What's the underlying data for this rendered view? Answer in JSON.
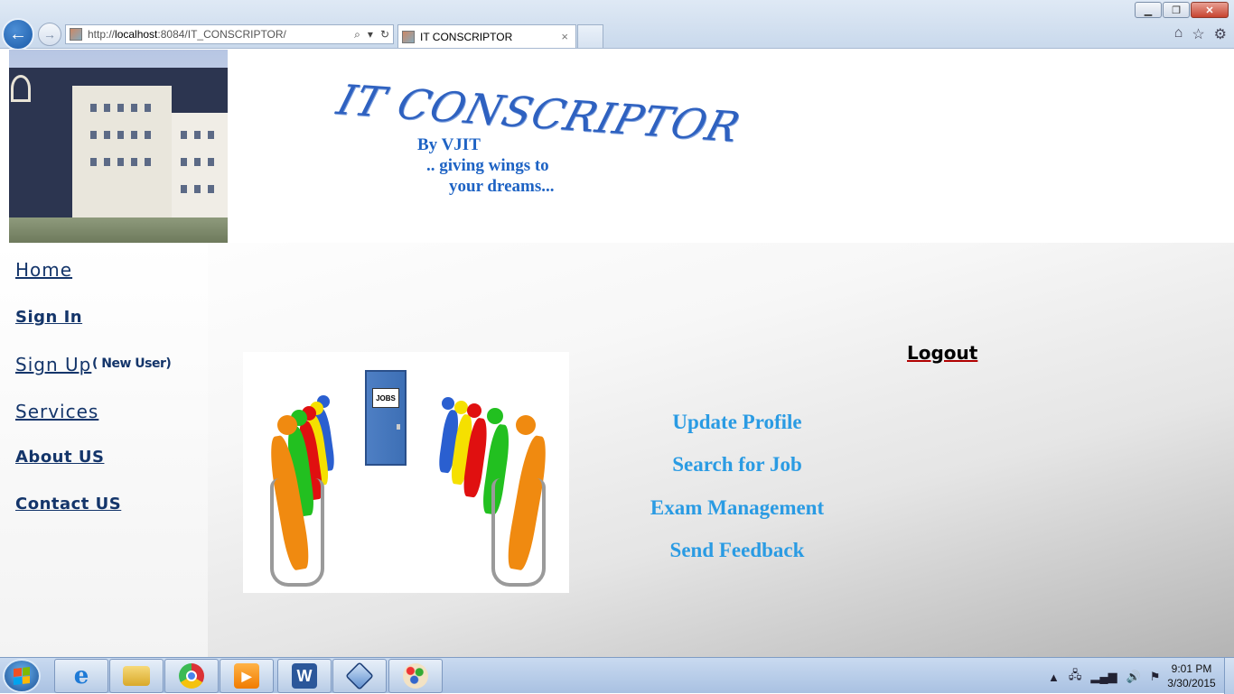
{
  "browser": {
    "url_prefix": "http://",
    "url_host": "localhost",
    "url_rest": ":8084/IT_CONSCRIPTOR/",
    "tab_title": "IT CONSCRIPTOR",
    "tab_close": "×"
  },
  "header": {
    "logo_text": "IT CONSCRIPTOR",
    "tagline_1": "By VJIT",
    "tagline_2": ".. giving wings to",
    "tagline_3": "your dreams..."
  },
  "sidebar": {
    "items": [
      {
        "label": "Home"
      },
      {
        "label": "Sign In"
      },
      {
        "label": "Sign Up"
      },
      {
        "label": "Services"
      },
      {
        "label": "About US"
      },
      {
        "label": "Contact US"
      }
    ],
    "new_user_note": "( New User)"
  },
  "main": {
    "logout_label": "Logout",
    "door_sign": "JOBS",
    "links": [
      {
        "label": "Update Profile"
      },
      {
        "label": "Search for Job"
      },
      {
        "label": "Exam Management"
      },
      {
        "label": "Send Feedback"
      }
    ]
  },
  "taskbar": {
    "time": "9:01 PM",
    "date": "3/30/2015"
  }
}
